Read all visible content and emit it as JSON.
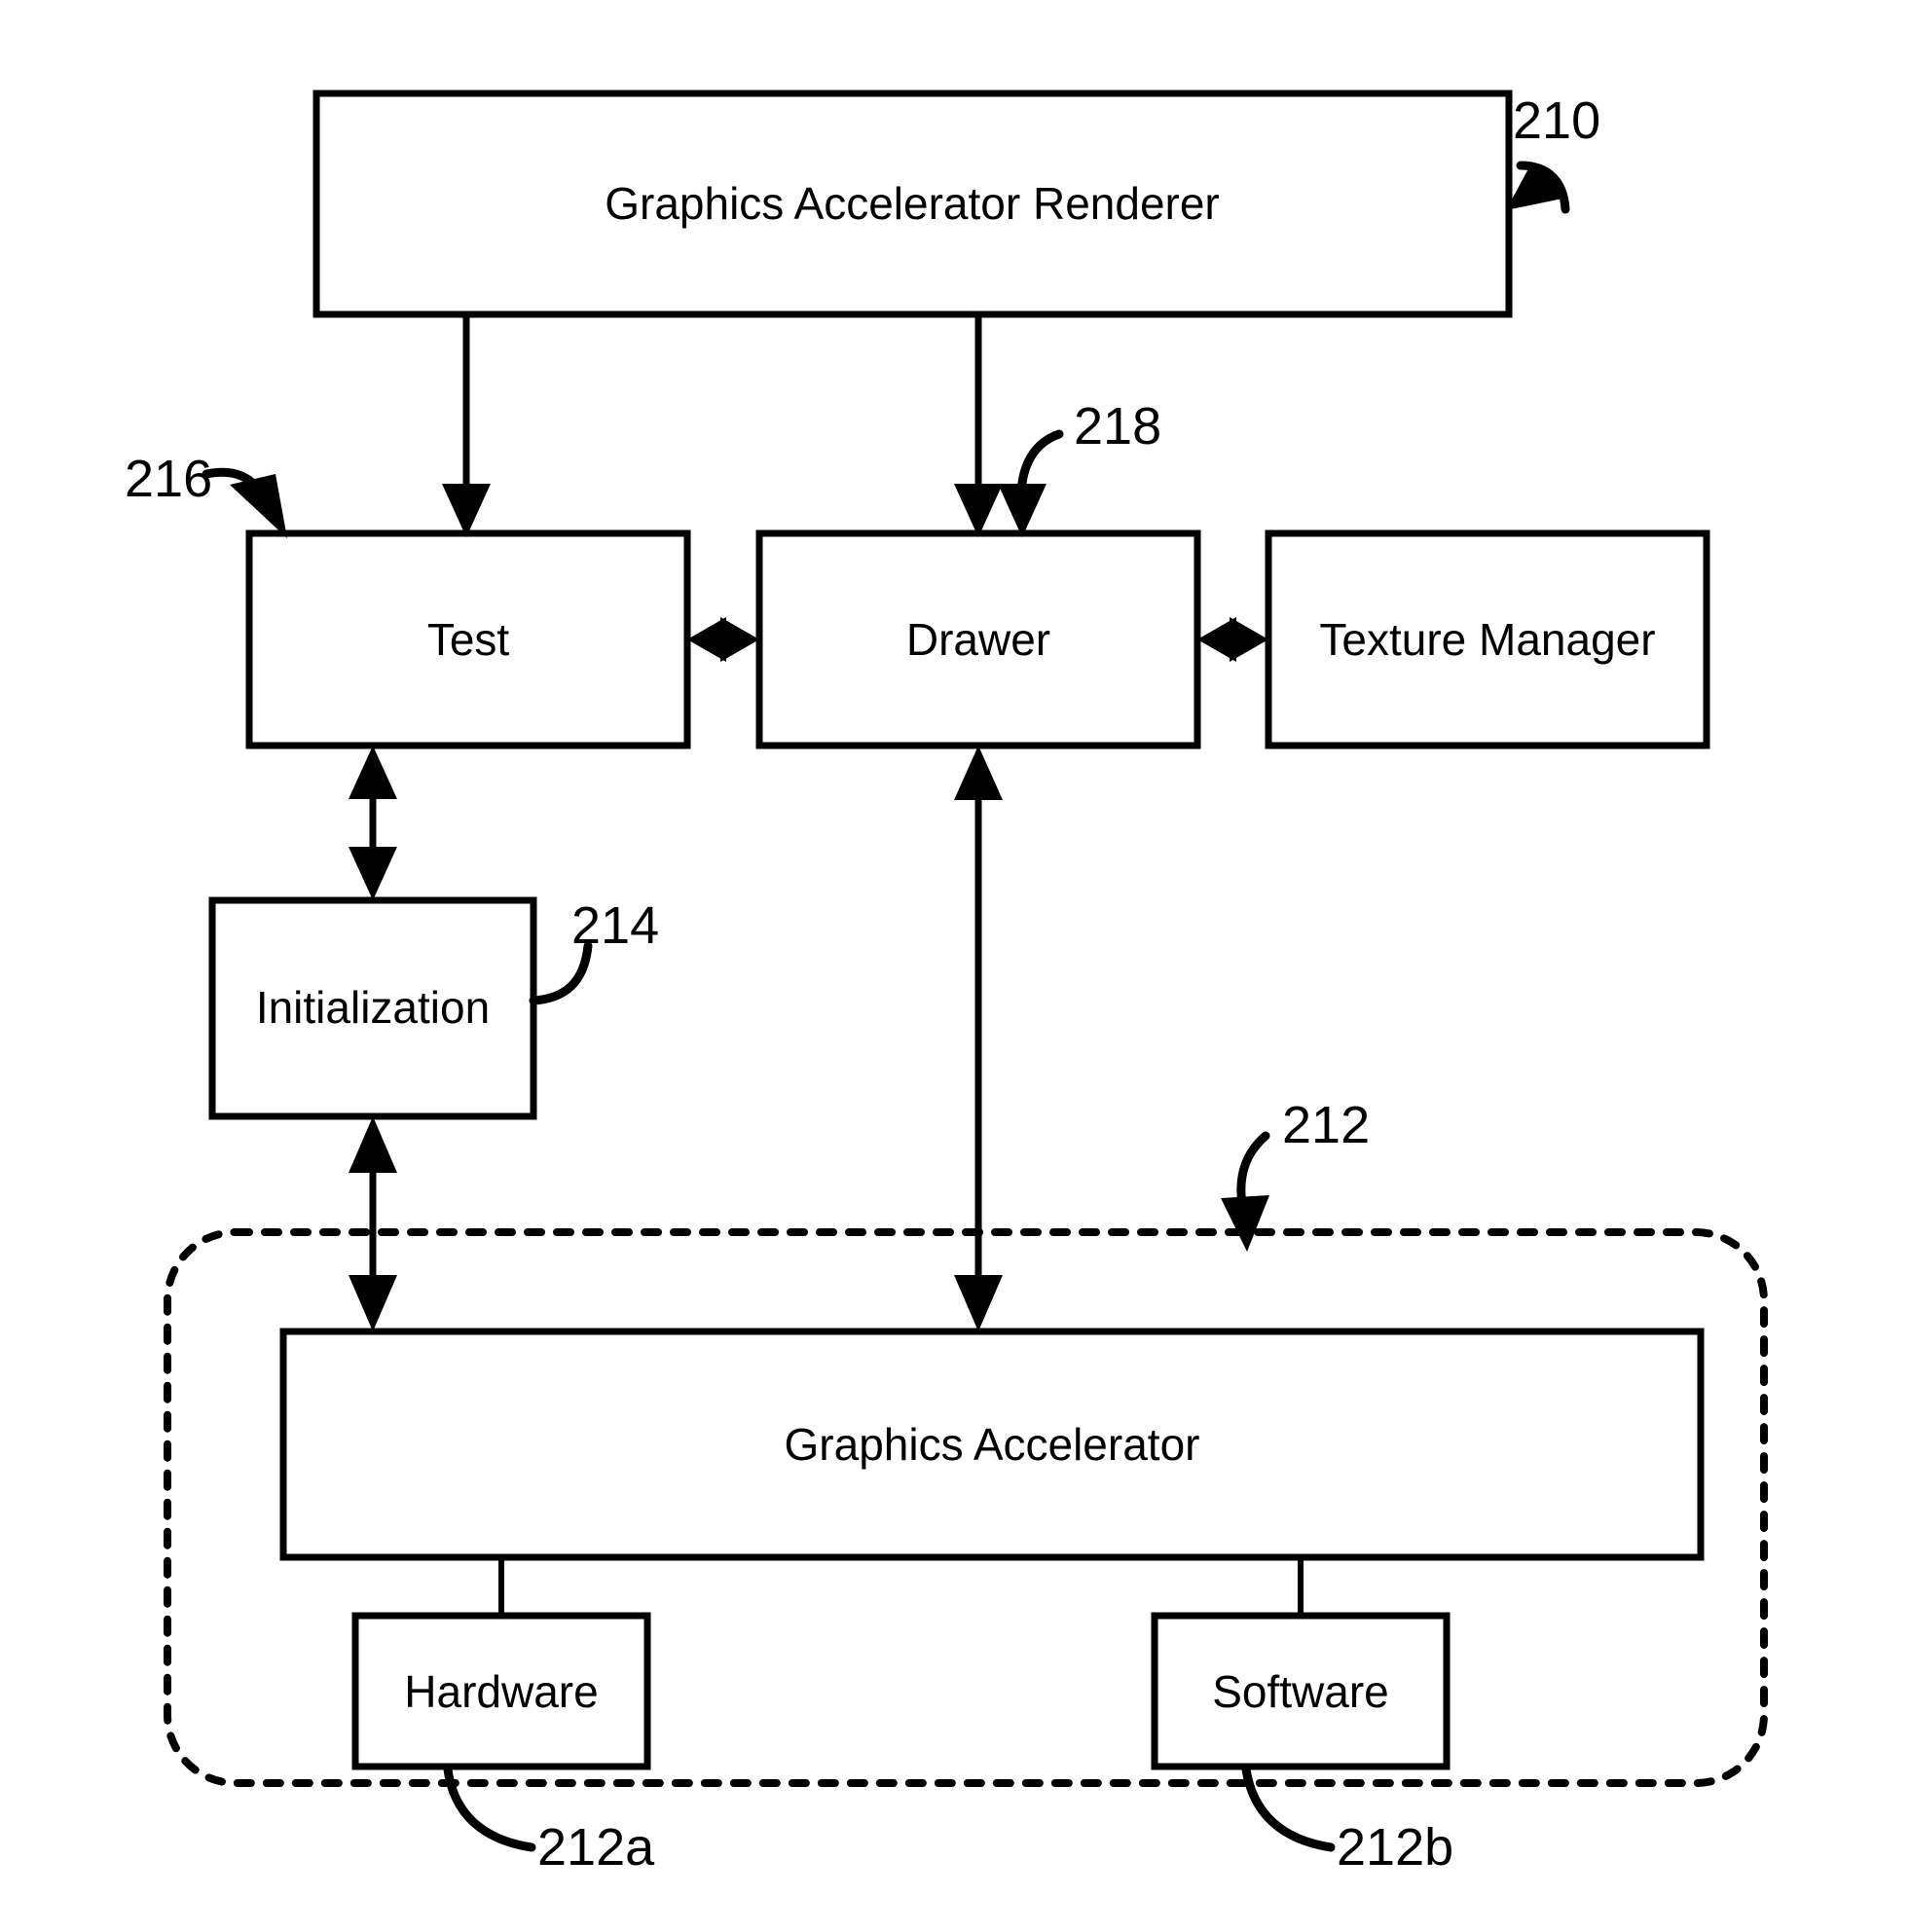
{
  "figure": {
    "type": "patent-block-diagram",
    "background_color": "#ffffff",
    "line_color": "#000000"
  },
  "blocks": {
    "renderer": {
      "label": "Graphics Accelerator Renderer",
      "ref": "210"
    },
    "test": {
      "label": "Test",
      "ref": "216"
    },
    "drawer": {
      "label": "Drawer",
      "ref": "218"
    },
    "texture_manager": {
      "label": "Texture Manager"
    },
    "initialization": {
      "label": "Initialization",
      "ref": "214"
    },
    "graphics_accelerator": {
      "label": "Graphics Accelerator",
      "ref": "212"
    },
    "hardware": {
      "label": "Hardware",
      "ref": "212a"
    },
    "software": {
      "label": "Software",
      "ref": "212b"
    }
  },
  "reference_numerals": {
    "renderer": "210",
    "accelerator_group": "212",
    "hardware": "212a",
    "software": "212b",
    "initialization": "214",
    "test": "216",
    "drawer": "218"
  }
}
